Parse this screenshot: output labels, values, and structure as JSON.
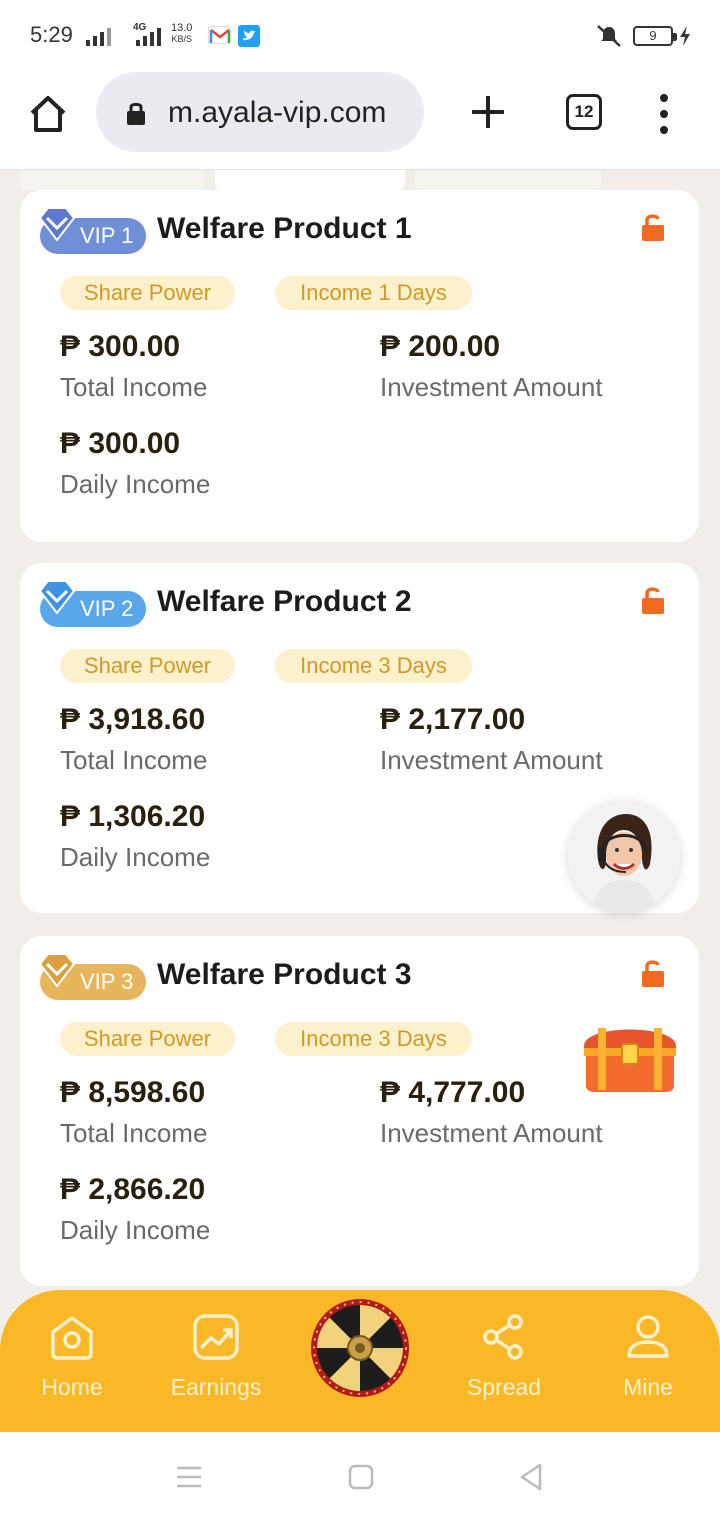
{
  "status_bar": {
    "time": "5:29",
    "network_type": "4G",
    "net_speed_value": "13.0",
    "net_speed_unit": "KB/S",
    "battery_level": "9"
  },
  "browser": {
    "url": "m.ayala-vip.com",
    "tab_count": "12"
  },
  "currency_symbol": "₱",
  "products": [
    {
      "vip": "VIP 1",
      "title": "Welfare Product 1",
      "tag_share": "Share Power",
      "tag_income": "Income 1 Days",
      "total_income": "₱ 300.00",
      "total_income_label": "Total Income",
      "investment_amount": "₱ 200.00",
      "investment_amount_label": "Investment Amount",
      "daily_income": "₱ 300.00",
      "daily_income_label": "Daily Income",
      "badge_color": "#6f8fd6"
    },
    {
      "vip": "VIP 2",
      "title": "Welfare Product 2",
      "tag_share": "Share Power",
      "tag_income": "Income 3 Days",
      "total_income": "₱ 3,918.60",
      "total_income_label": "Total Income",
      "investment_amount": "₱ 2,177.00",
      "investment_amount_label": "Investment Amount",
      "daily_income": "₱ 1,306.20",
      "daily_income_label": "Daily Income",
      "badge_color": "#5aa6ea"
    },
    {
      "vip": "VIP 3",
      "title": "Welfare Product 3",
      "tag_share": "Share Power",
      "tag_income": "Income 3 Days",
      "total_income": "₱ 8,598.60",
      "total_income_label": "Total Income",
      "investment_amount": "₱ 4,777.00",
      "investment_amount_label": "Investment Amount",
      "daily_income": "₱ 2,866.20",
      "daily_income_label": "Daily Income",
      "badge_color": "#e7b65c"
    }
  ],
  "bottom_nav": {
    "items": [
      {
        "label": "Home",
        "icon": "home-icon"
      },
      {
        "label": "Earnings",
        "icon": "earnings-chart-icon"
      },
      {
        "label": "",
        "icon": "lucky-wheel-icon"
      },
      {
        "label": "Spread",
        "icon": "share-icon"
      },
      {
        "label": "Mine",
        "icon": "user-icon"
      }
    ]
  },
  "colors": {
    "accent": "#fbb826",
    "tag_bg": "#fdf0cc",
    "tag_text": "#cf9a25",
    "lock": "#f06a20"
  }
}
